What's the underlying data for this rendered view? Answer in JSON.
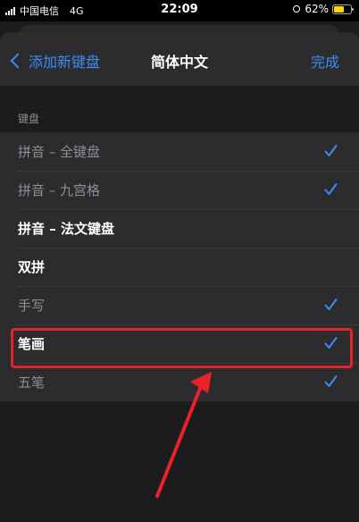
{
  "status_bar": {
    "carrier": "中国电信",
    "network": "4G",
    "time": "22:09",
    "battery_percent": "62%",
    "battery_level": 0.62
  },
  "nav": {
    "back_label": "添加新键盘",
    "title": "简体中文",
    "done_label": "完成"
  },
  "section": {
    "header": "键盘"
  },
  "keyboards": [
    {
      "label": "拼音 – 全键盘",
      "checked": true,
      "active": false
    },
    {
      "label": "拼音 – 九宫格",
      "checked": true,
      "active": false
    },
    {
      "label": "拼音 – 法文键盘",
      "checked": false,
      "active": true
    },
    {
      "label": "双拼",
      "checked": false,
      "active": true
    },
    {
      "label": "手写",
      "checked": true,
      "active": false
    },
    {
      "label": "笔画",
      "checked": true,
      "active": true
    },
    {
      "label": "五笔",
      "checked": true,
      "active": false
    }
  ],
  "colors": {
    "accent": "#3b8df5",
    "annotation": "#e8222a",
    "background": "#1c1c1e",
    "cell": "#2c2c2e"
  }
}
